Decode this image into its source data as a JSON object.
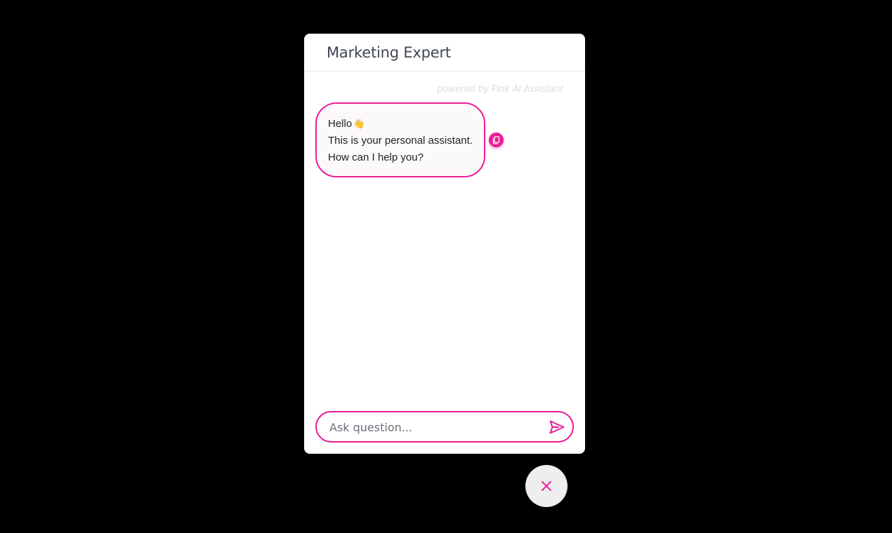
{
  "chat": {
    "title": "Marketing Expert",
    "powered_by": "powered by Pink AI Assistant",
    "message": {
      "line1": "Hello",
      "emoji": "👋",
      "line2": "This is your personal assistant.",
      "line3": "How can I help you?"
    },
    "input": {
      "placeholder": "Ask question...",
      "value": ""
    }
  },
  "icons": {
    "copy": "copy-icon",
    "send": "send-icon",
    "close": "close-icon",
    "wave": "waving-hand-emoji"
  },
  "colors": {
    "accent": "#e91e96",
    "background": "#000000",
    "panel": "#ffffff",
    "bubble": "#fcf9fa",
    "fab": "#eeeeee"
  }
}
